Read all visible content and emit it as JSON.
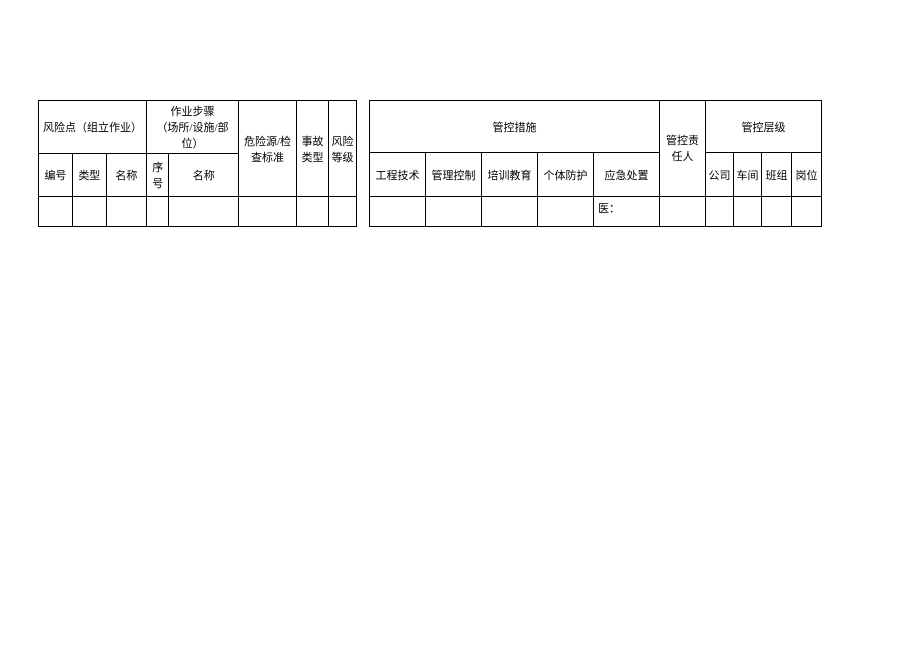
{
  "left": {
    "riskPoint": "风险点（组立作业）",
    "step": "作业步骤\n（场所/设施/部位）",
    "hazard": "危险源/检查标准",
    "accType": "事故类型",
    "riskLevel": "风险等级",
    "subId": "编号",
    "subType": "类型",
    "subName1": "名称",
    "subSeq": "序号",
    "subName2": "名称"
  },
  "right": {
    "measures": "管控措施",
    "respPerson": "管控责任人",
    "level": "管控层级",
    "m1": "工程技术",
    "m2": "管理控制",
    "m3": "培训教育",
    "m4": "个体防护",
    "m5": "应急处置",
    "l1": "公司",
    "l2": "车间",
    "l3": "班组",
    "l4": "岗位",
    "cellNote": "医："
  }
}
